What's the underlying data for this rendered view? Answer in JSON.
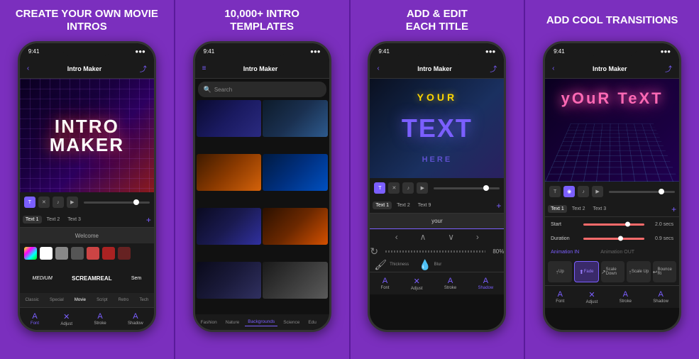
{
  "panels": [
    {
      "id": "panel1",
      "title": "CREATE YOUR OWN\nMOVIE INTROS",
      "phone": {
        "nav_title": "Intro Maker",
        "hero_text": "INTRO\nMAKER",
        "tabs": [
          "Text 1",
          "Text 2",
          "Text 3"
        ],
        "text_input_value": "Welcome",
        "font_names": [
          "MEDIUM",
          "SCREAMREAL",
          "Sem"
        ],
        "font_styles": [
          "Classic",
          "Special",
          "Movie",
          "Script",
          "Retro",
          "Tech"
        ],
        "bottom_tools": [
          "Font",
          "Adjust",
          "Stroke",
          "Shadow"
        ]
      }
    },
    {
      "id": "panel2",
      "title": "10,000+ INTRO\nTEMPLATES",
      "phone": {
        "nav_title": "Intro Maker",
        "search_placeholder": "Search",
        "tab_categories": [
          "Fashion",
          "Nature",
          "Backgrounds",
          "Science",
          "Edu"
        ],
        "active_tab": "Backgrounds"
      }
    },
    {
      "id": "panel3",
      "title": "ADD & EDIT\nEACH TITLE",
      "phone": {
        "nav_title": "Intro Maker",
        "hero_text_your": "YOUR",
        "hero_text_main": "TEXT",
        "hero_text_here": "HERE",
        "tabs": [
          "Text 1",
          "Text 2",
          "Text 9"
        ],
        "edit_value": "your",
        "percent": "80%",
        "thickness_label": "Thickness",
        "blur_label": "Blur",
        "bottom_tools": [
          "Font",
          "Adjust",
          "Stroke",
          "Shadow"
        ]
      }
    },
    {
      "id": "panel4",
      "title": "ADD COOL\nTRANSITIONS",
      "phone": {
        "nav_title": "Intro Maker",
        "hero_text": "yOuR TeXT",
        "tabs": [
          "Text 1",
          "Text 2",
          "Text 3"
        ],
        "start_label": "Start",
        "start_value": "2.0 secs",
        "duration_label": "Duration",
        "duration_value": "0.9 secs",
        "anim_in_label": "Animation IN",
        "anim_out_label": "Animation OUT",
        "anim_buttons": [
          "↑\nUp",
          "⬆\nFade",
          "↗\nScale Down",
          "↑\nScale Up",
          "↩\nBounce Ri"
        ],
        "bottom_tools": [
          "Font",
          "Adjust",
          "Stroke",
          "Shadow"
        ]
      }
    }
  ]
}
